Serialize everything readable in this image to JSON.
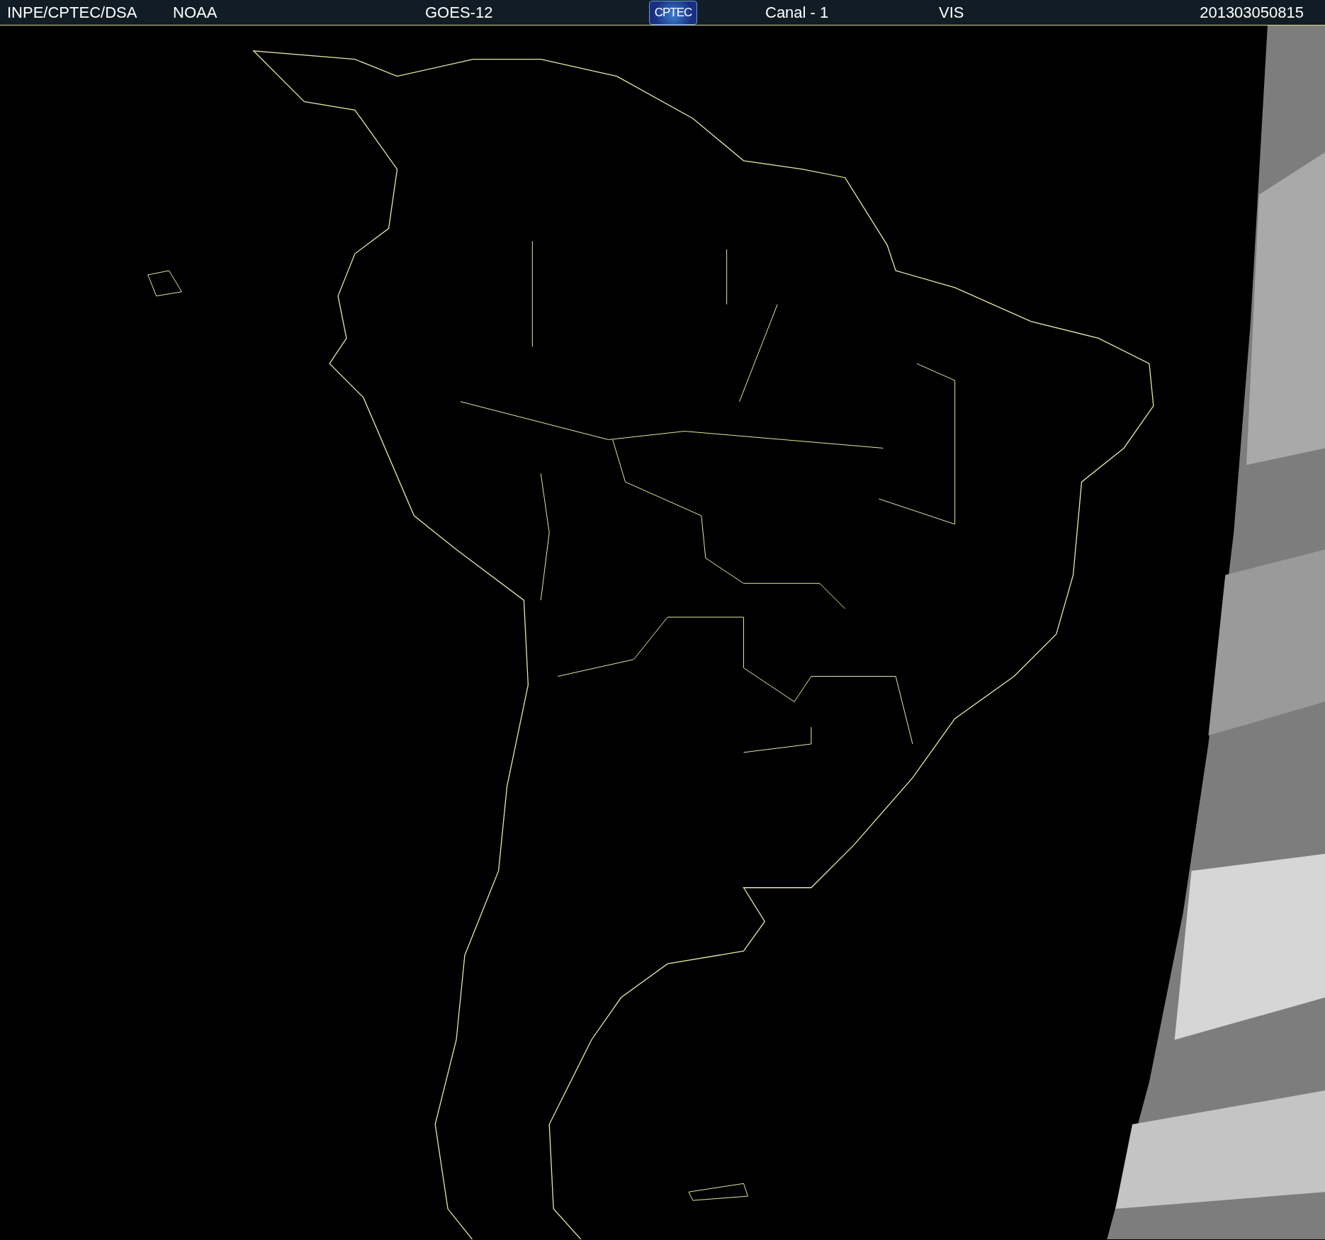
{
  "header": [
    {
      "kind": "text",
      "text": "INPE/CPTEC/DSA"
    },
    {
      "kind": "text",
      "text": "NOAA"
    },
    {
      "kind": "text",
      "text": "GOES-12"
    },
    {
      "kind": "logo",
      "text": "CPTEC"
    },
    {
      "kind": "text",
      "text": "Canal - 1"
    },
    {
      "kind": "text",
      "text": "VIS"
    },
    {
      "kind": "text",
      "text": "201303050815"
    }
  ]
}
